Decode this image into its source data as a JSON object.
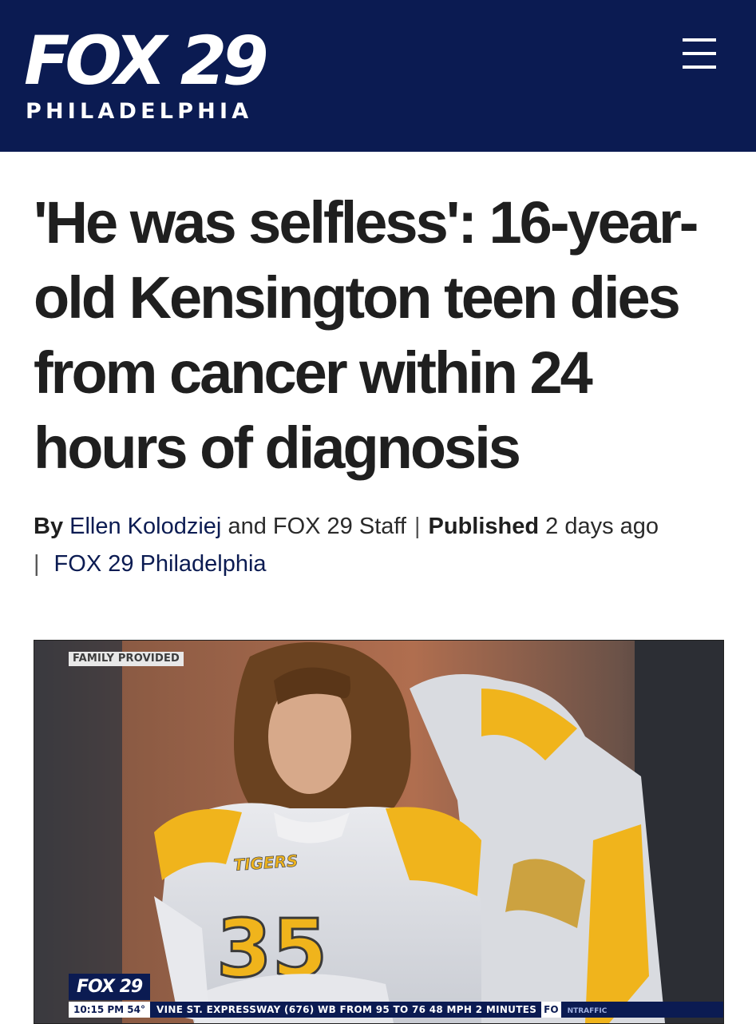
{
  "header": {
    "logo_main": "FOX 29",
    "logo_sub": "PHILADELPHIA",
    "background": "#0b1b52"
  },
  "article": {
    "headline": "'He was selfless': 16-year-old Kensington teen dies from cancer within 24 hours of diagnosis",
    "byline": {
      "by_label": "By",
      "author": "Ellen Kolodziej",
      "and_text": "and FOX 29 Staff",
      "published_label": "Published",
      "published_time": "2 days ago",
      "source": "FOX 29 Philadelphia"
    }
  },
  "media": {
    "credit": "FAMILY PROVIDED",
    "jersey_text": "TIGERS",
    "jersey_number": "35",
    "bug": "FOX 29",
    "ticker": {
      "time_temp": "10:15 PM  54°",
      "crawl": "VINE ST. EXPRESSWAY (676) WB FROM 95 TO 76 48 MPH   2 MINUTES",
      "logo": "FO",
      "tag": "NTRAFFIC"
    }
  },
  "colors": {
    "brand_navy": "#0b1b52",
    "jersey_gold": "#f0b41c",
    "headline_text": "#1f1f1f"
  },
  "icons": {
    "menu": "hamburger-menu-icon"
  }
}
